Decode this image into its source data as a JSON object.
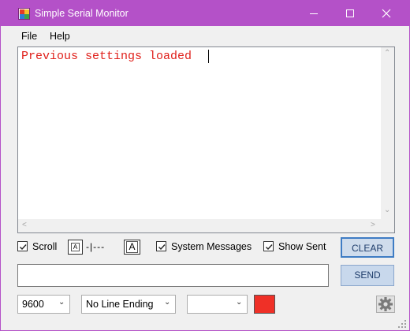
{
  "window": {
    "title": "Simple Serial Monitor"
  },
  "menu": {
    "file": "File",
    "help": "Help"
  },
  "output": {
    "text": "Previous settings loaded"
  },
  "options": {
    "scroll_label": "Scroll",
    "scroll_checked": true,
    "font_small_label": "A",
    "font_slider_text": "-|---",
    "font_large_label": "A",
    "system_messages_label": "System Messages",
    "system_messages_checked": true,
    "show_sent_label": "Show Sent",
    "show_sent_checked": true
  },
  "buttons": {
    "clear": "CLEAR",
    "send": "SEND"
  },
  "send_input": {
    "value": ""
  },
  "bottom": {
    "baud_rate": "9600",
    "line_ending": "No Line Ending",
    "port": "",
    "text_color": "#ef3027"
  },
  "colors": {
    "titlebar": "#b451c8",
    "output_text": "#e0201b"
  },
  "icons": {
    "app": "app-icon",
    "settings": "gear-icon"
  }
}
